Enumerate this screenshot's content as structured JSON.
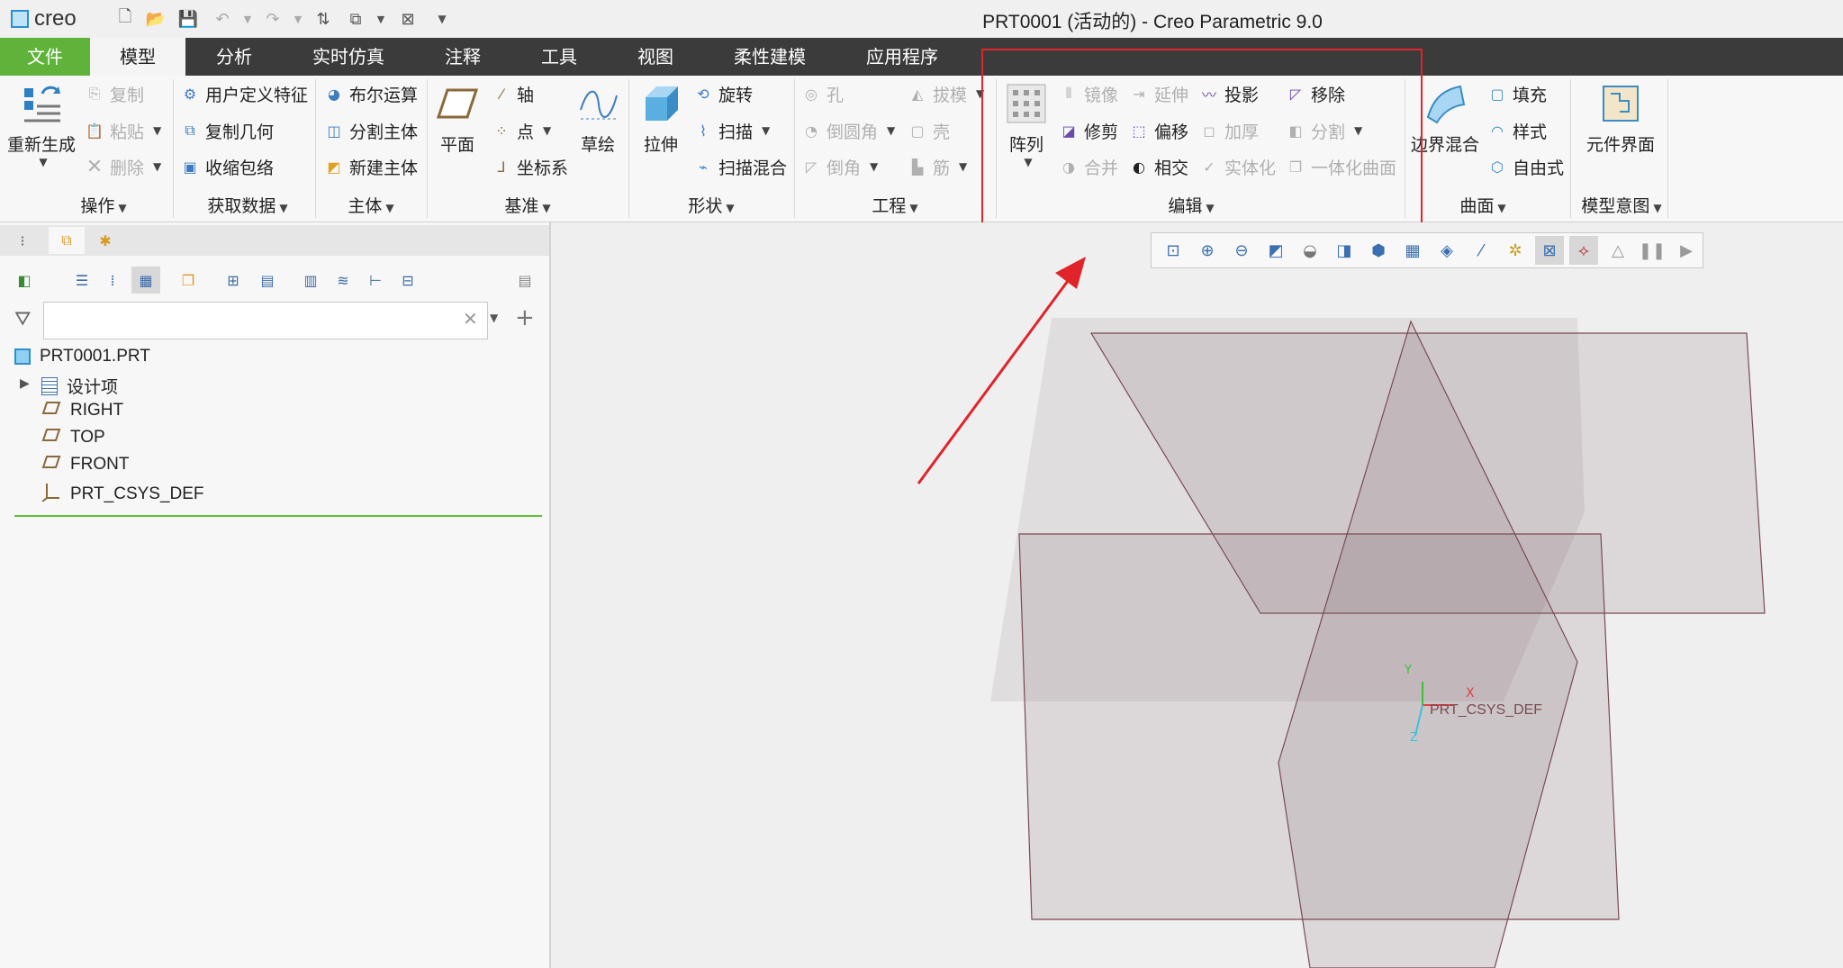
{
  "app": {
    "logo_text": "creo",
    "window_title": "PRT0001 (活动的) - Creo Parametric 9.0"
  },
  "tabs": [
    {
      "label": "文件"
    },
    {
      "label": "模型"
    },
    {
      "label": "分析"
    },
    {
      "label": "实时仿真"
    },
    {
      "label": "注释"
    },
    {
      "label": "工具"
    },
    {
      "label": "视图"
    },
    {
      "label": "柔性建模"
    },
    {
      "label": "应用程序"
    }
  ],
  "ribbon": {
    "operations": {
      "regenerate": "重新生成",
      "copy": "复制",
      "paste": "粘贴",
      "delete": "删除",
      "group": "操作"
    },
    "get_data": {
      "udf": "用户定义特征",
      "copy_geom": "复制几何",
      "shrinkwrap": "收缩包络",
      "group": "获取数据"
    },
    "body": {
      "boolean": "布尔运算",
      "split_body": "分割主体",
      "new_body": "新建主体",
      "group": "主体"
    },
    "datum": {
      "plane": "平面",
      "axis": "轴",
      "point": "点",
      "csys": "坐标系",
      "sketch": "草绘",
      "group": "基准"
    },
    "shapes": {
      "extrude": "拉伸",
      "revolve": "旋转",
      "sweep": "扫描",
      "swept_blend": "扫描混合",
      "group": "形状"
    },
    "engineering": {
      "hole": "孔",
      "round": "倒圆角",
      "chamfer": "倒角",
      "draft": "拔模",
      "shell": "壳",
      "rib": "筋",
      "group": "工程"
    },
    "editing": {
      "pattern": "阵列",
      "mirror": "镜像",
      "extend": "延伸",
      "project": "投影",
      "remove": "移除",
      "trim": "修剪",
      "offset": "偏移",
      "thicken": "加厚",
      "split": "分割",
      "merge": "合并",
      "intersect": "相交",
      "solidify": "实体化",
      "unify": "一体化曲面",
      "group": "编辑"
    },
    "surfaces": {
      "boundary_blend": "边界混合",
      "fill": "填充",
      "style": "样式",
      "freestyle": "自由式",
      "group": "曲面"
    },
    "model_intent": {
      "component_interface": "元件界面",
      "group": "模型意图"
    }
  },
  "model_tree": {
    "search_placeholder": "",
    "items": [
      {
        "label": "PRT0001.PRT",
        "icon": "part-icon"
      },
      {
        "label": "设计项",
        "icon": "design-items-icon"
      },
      {
        "label": "RIGHT",
        "icon": "datum-plane-icon"
      },
      {
        "label": "TOP",
        "icon": "datum-plane-icon"
      },
      {
        "label": "FRONT",
        "icon": "datum-plane-icon"
      },
      {
        "label": "PRT_CSYS_DEF",
        "icon": "csys-icon"
      }
    ]
  },
  "viewport": {
    "csys_label": "PRT_CSYS_DEF",
    "x_label": "X",
    "y_label": "Y",
    "z_label": "Z"
  },
  "colors": {
    "file_tab": "#5fb33a",
    "tab_bar": "#3b3b3b",
    "highlight_box": "#e0242a",
    "arrow": "#e0242a"
  }
}
